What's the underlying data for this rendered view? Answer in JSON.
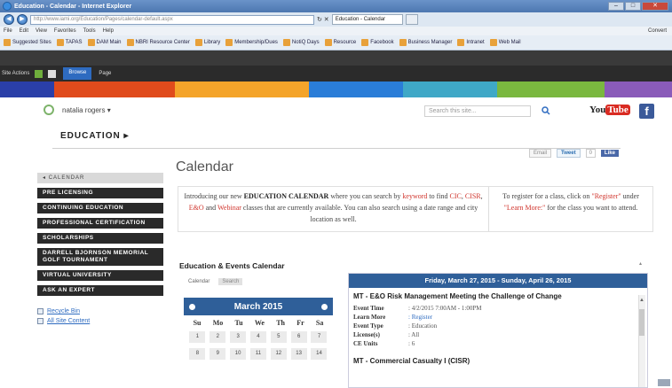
{
  "browser": {
    "title": "Education - Calendar - Internet Explorer",
    "url": "http://www.iami.org/Education/Pages/calendar-default.aspx",
    "tab_label": "Education - Calendar",
    "menu": [
      "File",
      "Edit",
      "View",
      "Favorites",
      "Tools",
      "Help"
    ],
    "convert_label": "Convert",
    "favorites": [
      "Suggested Sites",
      "TAPAS",
      "DAM Main",
      "NBRI Resource Center",
      "Library",
      "Membership/Dues",
      "NotiQ Days",
      "Resource",
      "Facebook",
      "Business Manager",
      "Intranet",
      "Web Mail"
    ]
  },
  "sharepoint": {
    "site_actions": "Site Actions",
    "browse_tab": "Browse",
    "page_tab": "Page"
  },
  "banner_colors": [
    "#2a3fa8",
    "#e04b1c",
    "#f4a42a",
    "#2a7dd8",
    "#3fa8c7",
    "#7ab83f",
    "#8a5bb9",
    "#c63a8f"
  ],
  "header": {
    "user_name": "natalia rogers",
    "search_placeholder": "Search this site...",
    "youtube_you": "You",
    "youtube_tube": "Tube",
    "facebook_label": "f"
  },
  "nav": {
    "section": "EDUCATION"
  },
  "leftnav": {
    "calendar": "CALENDAR",
    "items": [
      "PRE LICENSING",
      "CONTINUING EDUCATION",
      "PROFESSIONAL CERTIFICATION",
      "SCHOLARSHIPS",
      "DARRELL BJORNSON MEMORIAL GOLF TOURNAMENT",
      "VIRTUAL UNIVERSITY",
      "ASK AN EXPERT"
    ],
    "recycle_bin": "Recycle Bin",
    "all_site_content": "All Site Content"
  },
  "social": {
    "email": "Email",
    "tweet": "Tweet",
    "tweet_count": "0",
    "like": "Like"
  },
  "main": {
    "title": "Calendar",
    "intro_left": {
      "p1": "Introducing our new ",
      "b1": "EDUCATION CALENDAR",
      "p2": " where you can search by ",
      "r1": "keyword",
      "p3": " to find ",
      "r2": "CIC",
      "p4": ", ",
      "r3": "CISR",
      "p5": ", ",
      "r4": "E&O",
      "p6": " and ",
      "r5": "Webinar",
      "p7": " classes that are currently available. You can also search using a date range and city location as well."
    },
    "intro_right": {
      "p1": "To register for a class, click on ",
      "r1": "\"Register\"",
      "p2": " under ",
      "r2": "\"Learn More:\"",
      "p3": " for the class you want to attend."
    },
    "events_title": "Education & Events Calendar",
    "tabs": [
      "Calendar",
      "Search"
    ]
  },
  "calendar": {
    "month": "March 2015",
    "dows": [
      "Su",
      "Mo",
      "Tu",
      "We",
      "Th",
      "Fr",
      "Sa"
    ],
    "weeks": [
      [
        "1",
        "2",
        "3",
        "4",
        "5",
        "6",
        "7"
      ],
      [
        "8",
        "9",
        "10",
        "11",
        "12",
        "13",
        "14"
      ]
    ]
  },
  "events": {
    "range": "Friday, March 27, 2015 - Sunday, April 26, 2015",
    "event1": {
      "title": "MT - E&O Risk Management Meeting the Challenge of Change",
      "rows": [
        {
          "k": "Event Time",
          "v": ": 4/2/2015 7:00AM - 1:00PM"
        },
        {
          "k": "Learn More",
          "v": ": Register",
          "link": true
        },
        {
          "k": "Event Type",
          "v": ": Education"
        },
        {
          "k": "License(s)",
          "v": ": All"
        },
        {
          "k": "CE Units",
          "v": ": 6"
        }
      ]
    },
    "event2_title": "MT - Commercial Casualty I (CISR)"
  }
}
